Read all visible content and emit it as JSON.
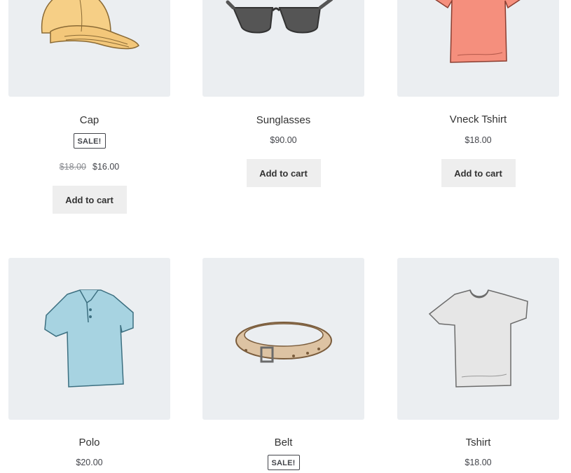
{
  "products": [
    {
      "name": "Cap",
      "sale_badge": "SALE!",
      "regular_price": "$18.00",
      "price": "$16.00",
      "button": "Add to cart",
      "icon": "cap-icon"
    },
    {
      "name": "Sunglasses",
      "price": "$90.00",
      "button": "Add to cart",
      "icon": "sunglasses-icon"
    },
    {
      "name": "Vneck Tshirt",
      "price": "$18.00",
      "button": "Add to cart",
      "icon": "vneck-tshirt-icon"
    },
    {
      "name": "Polo",
      "price": "$20.00",
      "icon": "polo-shirt-icon"
    },
    {
      "name": "Belt",
      "sale_badge": "SALE!",
      "icon": "belt-icon"
    },
    {
      "name": "Tshirt",
      "price": "$18.00",
      "icon": "tshirt-icon"
    }
  ],
  "colors": {
    "image_background": "#ebeef1",
    "button_background": "#eeeeee",
    "text": "#43454b"
  }
}
